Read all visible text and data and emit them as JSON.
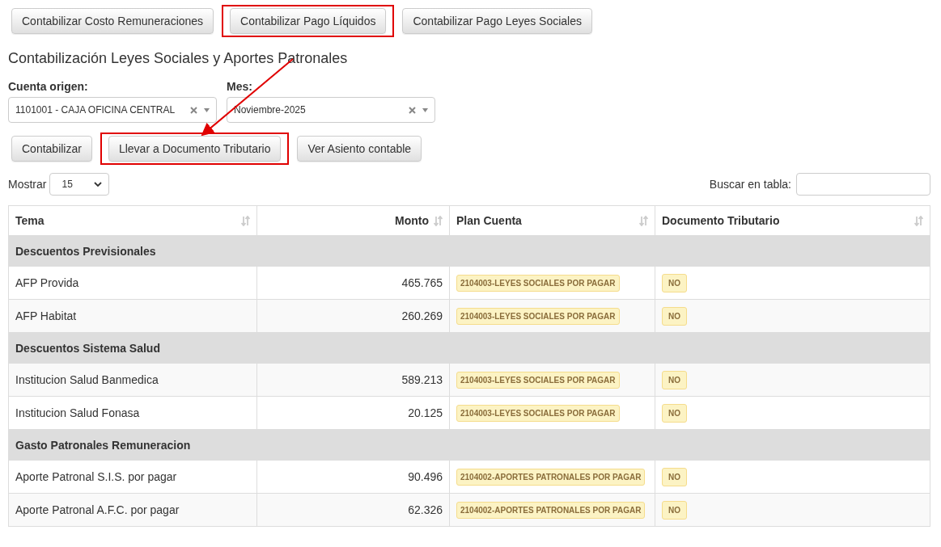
{
  "top_buttons": [
    {
      "label": "Contabilizar Costo Remuneraciones",
      "highlighted": false
    },
    {
      "label": "Contabilizar Pago Líquidos",
      "highlighted": true
    },
    {
      "label": "Contabilizar Pago Leyes Sociales",
      "highlighted": false
    }
  ],
  "title": "Contabilización Leyes Sociales y Aportes Patronales",
  "filters": [
    {
      "label": "Cuenta origen:",
      "value": "1101001 - CAJA OFICINA CENTRAL"
    },
    {
      "label": "Mes:",
      "value": "Noviembre-2025"
    }
  ],
  "action_buttons": [
    {
      "label": "Contabilizar",
      "highlighted": false
    },
    {
      "label": "Llevar a Documento Tributario",
      "highlighted": true
    },
    {
      "label": "Ver Asiento contable",
      "highlighted": false
    }
  ],
  "show": {
    "label": "Mostrar",
    "value": "15"
  },
  "search": {
    "label": "Buscar en tabla:"
  },
  "table": {
    "columns": [
      "Tema",
      "Monto",
      "Plan Cuenta",
      "Documento Tributario"
    ],
    "rows": [
      {
        "kind": "group",
        "tema": "Descuentos Previsionales"
      },
      {
        "kind": "item",
        "tema": "AFP Provida",
        "monto": "465.765",
        "plan": "2104003-LEYES SOCIALES POR PAGAR",
        "doc": "NO"
      },
      {
        "kind": "item",
        "tema": "AFP Habitat",
        "monto": "260.269",
        "plan": "2104003-LEYES SOCIALES POR PAGAR",
        "doc": "NO"
      },
      {
        "kind": "group",
        "tema": "Descuentos Sistema Salud"
      },
      {
        "kind": "item",
        "tema": "Institucion Salud Banmedica",
        "monto": "589.213",
        "plan": "2104003-LEYES SOCIALES POR PAGAR",
        "doc": "NO"
      },
      {
        "kind": "item",
        "tema": "Institucion Salud Fonasa",
        "monto": "20.125",
        "plan": "2104003-LEYES SOCIALES POR PAGAR",
        "doc": "NO"
      },
      {
        "kind": "group",
        "tema": "Gasto Patronales Remuneracion"
      },
      {
        "kind": "item",
        "tema": "Aporte Patronal S.I.S. por pagar",
        "monto": "90.496",
        "plan": "2104002-APORTES PATRONALES POR PAGAR",
        "doc": "NO"
      },
      {
        "kind": "item",
        "tema": "Aporte Patronal A.F.C. por pagar",
        "monto": "62.326",
        "plan": "2104002-APORTES PATRONALES POR PAGAR",
        "doc": "NO"
      }
    ]
  }
}
